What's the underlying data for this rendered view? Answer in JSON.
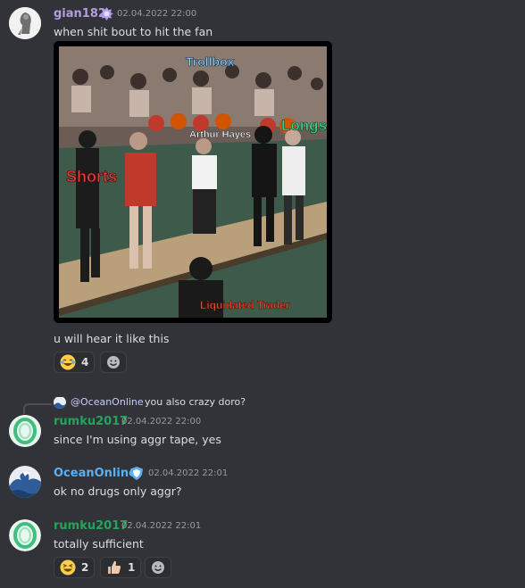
{
  "messages": [
    {
      "author": "gian182",
      "timestamp": "02.04.2022 22:00",
      "lines": [
        "when shit bout to hit the fan",
        "u will hear it like this"
      ],
      "author_color": "#b39ddb",
      "reactions": [
        {
          "emoji": "joy-emoji",
          "count": "4"
        }
      ],
      "media_labels": {
        "top": "Trollbox",
        "center": "Arthur Hayes",
        "left": "Shorts",
        "right": "Longs",
        "bottom": "Liquidated Trader"
      }
    },
    {
      "reply": {
        "mention": "@OceanOnline",
        "text": "you also crazy doro?"
      },
      "author": "rumku2017",
      "timestamp": "02.04.2022 22:00",
      "text": "since I'm using aggr tape, yes",
      "author_color": "#23a559"
    },
    {
      "author": "OceanOnline",
      "timestamp": "02.04.2022 22:01",
      "text": "ok no drugs only aggr?",
      "author_color": "#5ab0f2"
    },
    {
      "author": "rumku2017",
      "timestamp": "02.04.2022 22:01",
      "text": "totally sufficient",
      "author_color": "#23a559",
      "reactions": [
        {
          "emoji": "laughing-emoji",
          "count": "2"
        },
        {
          "emoji": "thumbs-up-emoji",
          "count": "1"
        }
      ]
    }
  ],
  "colors": {
    "background": "#313338",
    "mention": "#c9cdfb",
    "timestamp": "#949ba4"
  }
}
